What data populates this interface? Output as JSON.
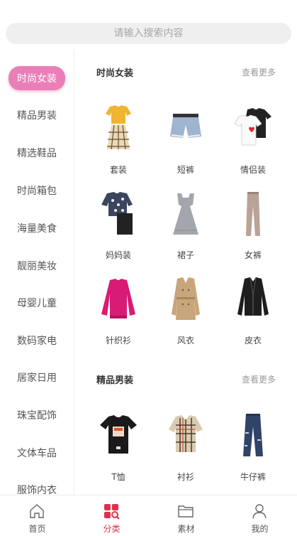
{
  "search": {
    "placeholder": "请输入搜索内容"
  },
  "colors": {
    "accent": "#e97fb6",
    "tab_active": "#e0304a"
  },
  "sidebar": {
    "items": [
      {
        "label": "时尚女装",
        "active": true
      },
      {
        "label": "精品男装"
      },
      {
        "label": "精选鞋品"
      },
      {
        "label": "时尚箱包"
      },
      {
        "label": "海量美食"
      },
      {
        "label": "靓丽美妆"
      },
      {
        "label": "母婴儿童"
      },
      {
        "label": "数码家电"
      },
      {
        "label": "居家日用"
      },
      {
        "label": "珠宝配饰"
      },
      {
        "label": "文体车品"
      },
      {
        "label": "服饰内衣"
      }
    ]
  },
  "sections": [
    {
      "title": "时尚女装",
      "more": "查看更多",
      "items": [
        {
          "label": "套装",
          "icon": "outfit-set-icon"
        },
        {
          "label": "短裤",
          "icon": "shorts-icon"
        },
        {
          "label": "情侣装",
          "icon": "couple-tshirt-icon"
        },
        {
          "label": "妈妈装",
          "icon": "mom-outfit-icon"
        },
        {
          "label": "裙子",
          "icon": "dress-icon"
        },
        {
          "label": "女裤",
          "icon": "trousers-icon"
        },
        {
          "label": "针织衫",
          "icon": "sweater-icon"
        },
        {
          "label": "风衣",
          "icon": "trench-coat-icon"
        },
        {
          "label": "皮衣",
          "icon": "leather-jacket-icon"
        }
      ]
    },
    {
      "title": "精品男装",
      "more": "查看更多",
      "items": [
        {
          "label": "T恤",
          "icon": "tshirt-icon"
        },
        {
          "label": "衬衫",
          "icon": "plaid-shirt-icon"
        },
        {
          "label": "牛仔裤",
          "icon": "jeans-icon"
        }
      ]
    }
  ],
  "tabbar": {
    "tabs": [
      {
        "label": "首页",
        "icon": "home-icon"
      },
      {
        "label": "分类",
        "icon": "category-icon",
        "active": true
      },
      {
        "label": "素材",
        "icon": "folder-icon"
      },
      {
        "label": "我的",
        "icon": "user-icon"
      }
    ]
  }
}
